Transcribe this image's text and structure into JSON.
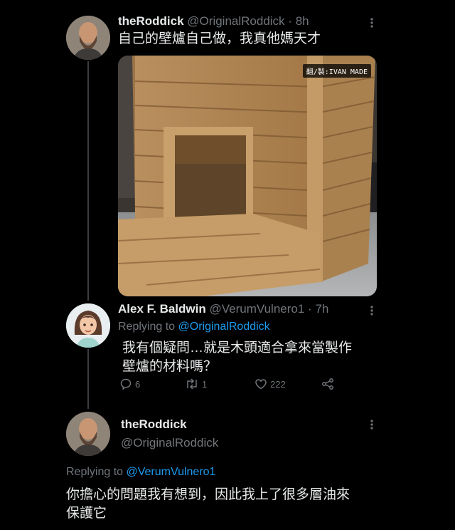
{
  "tweets": [
    {
      "name": "theRoddick",
      "handle": "@OriginalRoddick",
      "time": "8h",
      "text": "自己的壁爐自己做，我真他媽天才",
      "media": {
        "watermark": "翻/製:IVAN MADE"
      }
    },
    {
      "name": "Alex F. Baldwin",
      "handle": "@VerumVulnero1",
      "time": "7h",
      "replying_prefix": "Replying to",
      "replying_to": "@OriginalRoddick",
      "text_line1": "我有個疑問…就是木頭適合拿來當製作",
      "text_line2": "壁爐的材料嗎？",
      "actions": {
        "replies": "6",
        "retweets": "1",
        "likes": "222"
      }
    },
    {
      "name": "theRoddick",
      "handle": "@OriginalRoddick",
      "replying_prefix": "Replying to",
      "replying_to": "@VerumVulnero1",
      "text_line1": "你擔心的問題我有想到，因此我上了很多層油來",
      "text_line2": "保護它"
    }
  ],
  "icons": [
    "reply-icon",
    "retweet-icon",
    "like-icon",
    "share-icon",
    "more-icon"
  ],
  "colors": {
    "background": "#000000",
    "text": "#e7e9ea",
    "muted": "#71767b",
    "link": "#1d9bf0",
    "thread_line": "#3a3d41"
  }
}
